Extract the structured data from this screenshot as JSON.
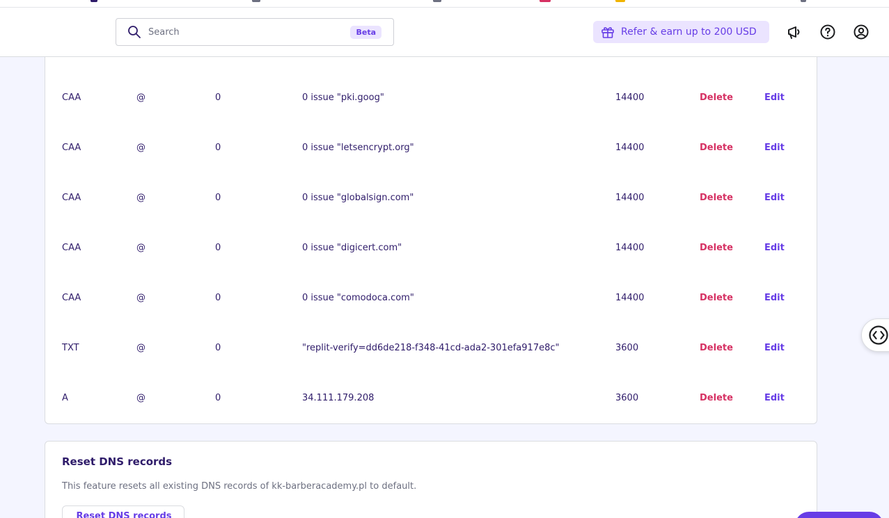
{
  "header": {
    "search": {
      "placeholder": "Search",
      "badge": "Beta",
      "icon": "search-icon"
    },
    "refer": {
      "label": "Refer & earn up to 200 USD",
      "icon": "gift-icon"
    },
    "icons": [
      "megaphone-icon",
      "help-icon",
      "account-icon"
    ]
  },
  "dns_records": [
    {
      "type": "CAA",
      "name": "@",
      "priority": "0",
      "content": "0 issue \"pki.goog\"",
      "ttl": "14400",
      "delete": "Delete",
      "edit": "Edit"
    },
    {
      "type": "CAA",
      "name": "@",
      "priority": "0",
      "content": "0 issue \"letsencrypt.org\"",
      "ttl": "14400",
      "delete": "Delete",
      "edit": "Edit"
    },
    {
      "type": "CAA",
      "name": "@",
      "priority": "0",
      "content": "0 issue \"globalsign.com\"",
      "ttl": "14400",
      "delete": "Delete",
      "edit": "Edit"
    },
    {
      "type": "CAA",
      "name": "@",
      "priority": "0",
      "content": "0 issue \"digicert.com\"",
      "ttl": "14400",
      "delete": "Delete",
      "edit": "Edit"
    },
    {
      "type": "CAA",
      "name": "@",
      "priority": "0",
      "content": "0 issue \"comodoca.com\"",
      "ttl": "14400",
      "delete": "Delete",
      "edit": "Edit"
    },
    {
      "type": "TXT",
      "name": "@",
      "priority": "0",
      "content": "\"replit-verify=dd6de218-f348-41cd-ada2-301efa917e8c\"",
      "ttl": "3600",
      "delete": "Delete",
      "edit": "Edit"
    },
    {
      "type": "A",
      "name": "@",
      "priority": "0",
      "content": "34.111.179.208",
      "ttl": "3600",
      "delete": "Delete",
      "edit": "Edit"
    }
  ],
  "reset": {
    "title": "Reset DNS records",
    "description": "This feature resets all existing DNS records of kk-barberacademy.pl to default.",
    "button": "Reset DNS records"
  },
  "colors": {
    "accent": "#673de6",
    "danger": "#d63163",
    "background": "#f4f5ff",
    "text": "#2f1c6a"
  }
}
